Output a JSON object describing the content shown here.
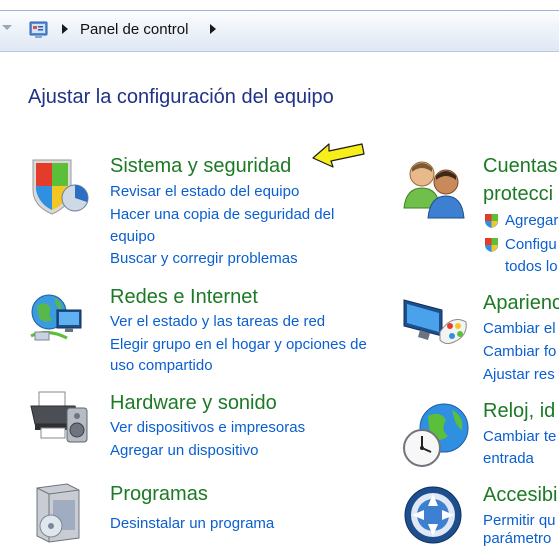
{
  "address_bar": {
    "breadcrumb": "Panel de control"
  },
  "page": {
    "title": "Ajustar la configuración del equipo"
  },
  "left_categories": [
    {
      "title": "Sistema y seguridad",
      "links": [
        "Revisar el estado del equipo",
        "Hacer una copia de seguridad del",
        "equipo",
        "Buscar y corregir problemas"
      ],
      "icon": "shield-icon"
    },
    {
      "title": "Redes e Internet",
      "links": [
        "Ver el estado y las tareas de red",
        "Elegir grupo en el hogar y opciones de",
        "uso compartido"
      ],
      "icon": "network-globe-icon"
    },
    {
      "title": "Hardware y sonido",
      "links": [
        "Ver dispositivos e impresoras",
        "Agregar un dispositivo"
      ],
      "icon": "printer-icon"
    },
    {
      "title": "Programas",
      "links": [
        "Desinstalar un programa"
      ],
      "icon": "programs-box-icon"
    }
  ],
  "right_categories": [
    {
      "title_lines": [
        "Cuentas",
        "protecci"
      ],
      "links": [
        "Agregar",
        "Configu",
        "todos lo"
      ],
      "icon": "users-icon"
    },
    {
      "title": "Aparienc",
      "links": [
        "Cambiar el",
        "Cambiar fo",
        "Ajustar res"
      ],
      "icon": "display-appearance-icon"
    },
    {
      "title": "Reloj, id",
      "links": [
        "Cambiar te",
        "entrada"
      ],
      "icon": "clock-globe-icon"
    },
    {
      "title": "Accesibi",
      "links": [
        "Permitir qu",
        "parámetro"
      ],
      "icon": "accessibility-icon"
    }
  ],
  "colors": {
    "category_title": "#1c7a25",
    "link": "#0a5fd1",
    "page_title": "#1e3287",
    "annotation_arrow": "#f7ee1a"
  }
}
